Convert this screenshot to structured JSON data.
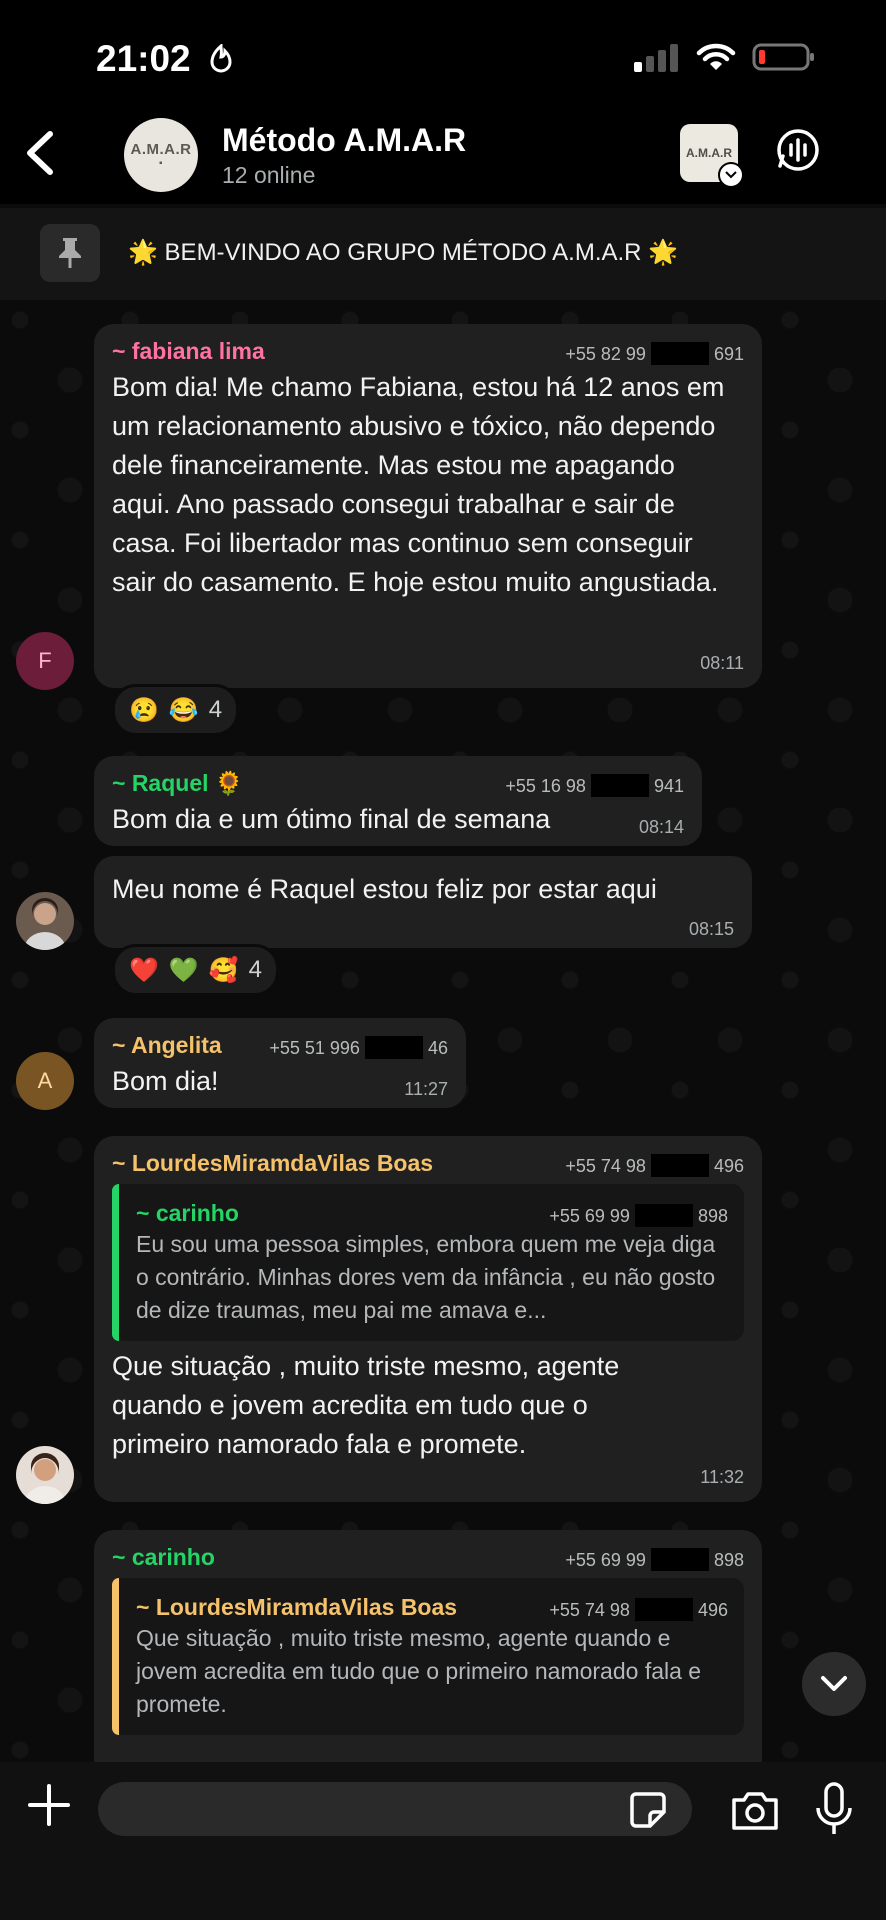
{
  "status_bar": {
    "time": "21:02"
  },
  "header": {
    "group_name": "Método A.M.A.R",
    "online": "12 online",
    "avatar_text": "A.M.A.R",
    "thumb_text": "A.M.A.R"
  },
  "pinned": {
    "text": "🌟 BEM-VINDO AO GRUPO MÉTODO A.M.A.R 🌟"
  },
  "messages": {
    "fabiana": {
      "sender": "~ fabiana lima",
      "phone_prefix": "+55 82 99",
      "phone_suffix": "691",
      "body": "Bom dia! Me chamo Fabiana, estou há 12 anos em um relacionamento abusivo e tóxico, não dependo dele financeiramente. Mas estou me apagando aqui. Ano passado consegui trabalhar e sair de casa. Foi libertador mas continuo sem conseguir sair do casamento. E hoje estou muito angustiada.",
      "time": "08:11",
      "avatar_letter": "F",
      "reactions": [
        "😢",
        "😂"
      ],
      "reaction_count": "4"
    },
    "raquel1": {
      "sender": "~ Raquel 🌻",
      "phone_prefix": "+55 16 98",
      "phone_suffix": "941",
      "body": "Bom dia e um ótimo final de semana",
      "time": "08:14"
    },
    "raquel2": {
      "body": "Meu nome é Raquel estou feliz por estar aqui",
      "time": "08:15",
      "reactions": [
        "❤️",
        "💚",
        "🥰"
      ],
      "reaction_count": "4"
    },
    "angelita": {
      "sender": "~ Angelita",
      "phone_prefix": "+55 51 996",
      "phone_suffix": "46",
      "body": "Bom dia!",
      "time": "11:27",
      "avatar_letter": "A"
    },
    "lourdes": {
      "sender": "~ LourdesMiramdaVilas Boas",
      "phone_prefix": "+55 74 98",
      "phone_suffix": "496",
      "quote_sender": "~ carinho",
      "quote_phone_prefix": "+55 69 99",
      "quote_phone_suffix": "898",
      "quote_text": "Eu sou uma pessoa simples, embora quem me veja diga o contrário. Minhas dores vem da infância , eu não gosto de dize traumas, meu pai me amava e...",
      "body": "Que situação , muito triste mesmo, agente quando e jovem acredita em tudo que o primeiro namorado fala e promete.",
      "time": "11:32"
    },
    "carinho": {
      "sender": "~ carinho",
      "phone_prefix": "+55 69 99",
      "phone_suffix": "898",
      "quote_sender": "~ LourdesMiramdaVilas Boas",
      "quote_phone_prefix": "+55 74 98",
      "quote_phone_suffix": "496",
      "quote_text": "Que situação , muito triste mesmo, agente  quando e jovem acredita em tudo que o primeiro namorado fala e promete."
    }
  },
  "composer": {
    "placeholder": ""
  },
  "colors": {
    "fabiana": "#ff72a1",
    "raquel": "#25d366",
    "angelita": "#f5c26b",
    "lourdes": "#f5c26b",
    "carinho": "#25d366"
  }
}
